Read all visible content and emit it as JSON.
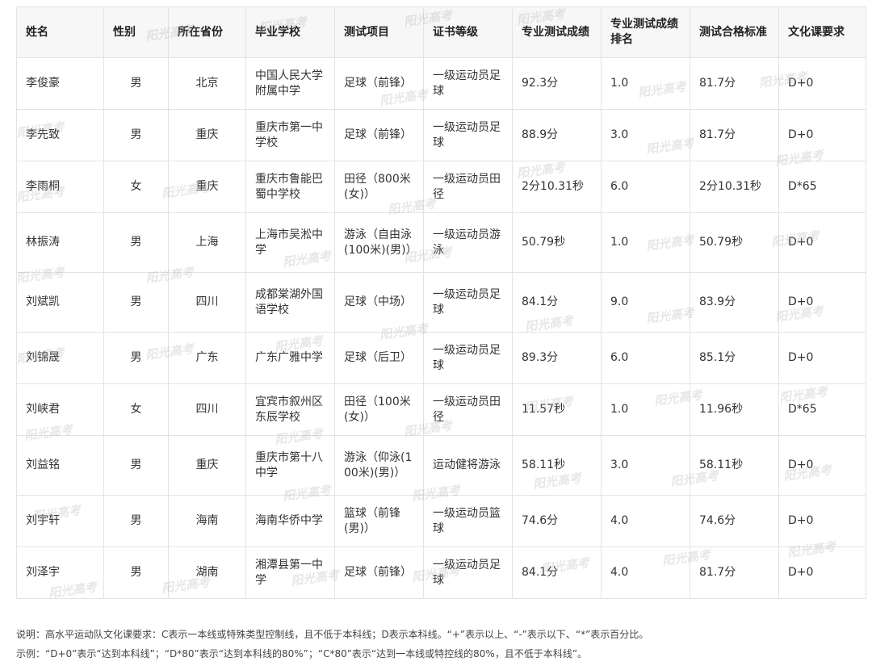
{
  "watermark": "阳光高考",
  "table": {
    "headers": [
      "姓名",
      "性别",
      "所在省份",
      "毕业学校",
      "测试项目",
      "证书等级",
      "专业测试成绩",
      "专业测试成绩排名",
      "测试合格标准",
      "文化课要求"
    ],
    "rows": [
      [
        "李俊豪",
        "男",
        "北京",
        "中国人民大学附属中学",
        "足球（前锋）",
        "一级运动员足球",
        "92.3分",
        "1.0",
        "81.7分",
        "D+0"
      ],
      [
        "李先致",
        "男",
        "重庆",
        "重庆市第一中学校",
        "足球（前锋）",
        "一级运动员足球",
        "88.9分",
        "3.0",
        "81.7分",
        "D+0"
      ],
      [
        "李雨桐",
        "女",
        "重庆",
        "重庆市鲁能巴蜀中学校",
        "田径（800米(女)）",
        "一级运动员田径",
        "2分10.31秒",
        "6.0",
        "2分10.31秒",
        "D*65"
      ],
      [
        "林振涛",
        "男",
        "上海",
        "上海市吴淞中学",
        "游泳（自由泳(100米)(男)）",
        "一级运动员游泳",
        "50.79秒",
        "1.0",
        "50.79秒",
        "D+0"
      ],
      [
        "刘斌凯",
        "男",
        "四川",
        "成都棠湖外国语学校",
        "足球（中场）",
        "一级运动员足球",
        "84.1分",
        "9.0",
        "83.9分",
        "D+0"
      ],
      [
        "刘锦晟",
        "男",
        "广东",
        "广东广雅中学",
        "足球（后卫）",
        "一级运动员足球",
        "89.3分",
        "6.0",
        "85.1分",
        "D+0"
      ],
      [
        "刘峡君",
        "女",
        "四川",
        "宜宾市叙州区东辰学校",
        "田径（100米(女)）",
        "一级运动员田径",
        "11.57秒",
        "1.0",
        "11.96秒",
        "D*65"
      ],
      [
        "刘益铭",
        "男",
        "重庆",
        "重庆市第十八中学",
        "游泳（仰泳(100米)(男)）",
        "运动健将游泳",
        "58.11秒",
        "3.0",
        "58.11秒",
        "D+0"
      ],
      [
        "刘宇轩",
        "男",
        "海南",
        "海南华侨中学",
        "篮球（前锋(男)）",
        "一级运动员篮球",
        "74.6分",
        "4.0",
        "74.6分",
        "D+0"
      ],
      [
        "刘泽宇",
        "男",
        "湖南",
        "湘潭县第一中学",
        "足球（前锋）",
        "一级运动员足球",
        "84.1分",
        "4.0",
        "81.7分",
        "D+0"
      ]
    ]
  },
  "notes": {
    "line1": "说明：高水平运动队文化课要求：C表示一本线或特殊类型控制线，且不低于本科线；D表示本科线。“+”表示以上、“-”表示以下、“*”表示百分比。",
    "line2": "示例：“D+0”表示“达到本科线”；“D*80”表示“达到本科线的80%”；“C*80”表示“达到一本线或特控线的80%，且不低于本科线”。"
  }
}
